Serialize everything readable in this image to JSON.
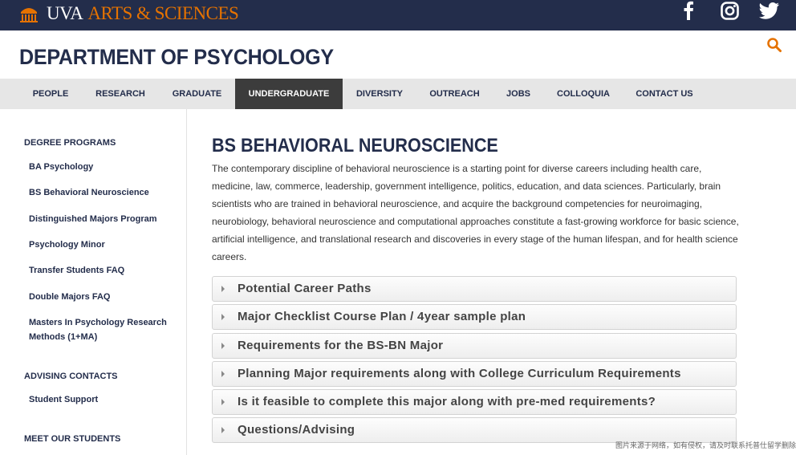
{
  "brand": {
    "uva": "UVA",
    "arts": "ARTS & SCIENCES",
    "accent": "#e57200",
    "navy": "#232d4b"
  },
  "social": [
    "facebook-icon",
    "instagram-icon",
    "twitter-icon"
  ],
  "header": {
    "title": "DEPARTMENT OF PSYCHOLOGY"
  },
  "nav": {
    "items": [
      "PEOPLE",
      "RESEARCH",
      "GRADUATE",
      "UNDERGRADUATE",
      "DIVERSITY",
      "OUTREACH",
      "JOBS",
      "COLLOQUIA",
      "CONTACT US"
    ],
    "active": "UNDERGRADUATE"
  },
  "sidebar": {
    "degree_heading": "DEGREE PROGRAMS",
    "degree_items": [
      "BA Psychology",
      "BS Behavioral Neuroscience",
      "Distinguished Majors Program",
      "Psychology Minor",
      "Transfer Students FAQ",
      "Double Majors FAQ",
      "Masters In Psychology Research Methods (1+MA)"
    ],
    "advising_heading": "ADVISING CONTACTS",
    "advising_items": [
      "Student Support"
    ],
    "students_heading": "MEET OUR STUDENTS"
  },
  "main": {
    "title": "BS BEHAVIORAL NEUROSCIENCE",
    "intro": "The contemporary discipline of behavioral neuroscience is a starting point for diverse careers including health care, medicine, law, commerce, leadership, government intelligence, politics, education, and data sciences. Particularly, brain scientists who are trained in behavioral neuroscience, and acquire the background competencies for neuroimaging, neurobiology, behavioral neuroscience and computational approaches constitute a fast-growing workforce for basic science, artificial intelligence, and translational research and discoveries in every stage of the human lifespan, and for health science careers.",
    "accordions": [
      "Potential Career Paths",
      "Major Checklist Course Plan / 4year sample plan",
      "Requirements for the BS-BN Major",
      "Planning Major requirements along with College Curriculum Requirements",
      "Is it feasible to complete this major along with pre-med requirements?",
      "Questions/Advising"
    ]
  },
  "watermark": "图片来源于网络，如有侵权，请及时联系托普仕留学删除"
}
